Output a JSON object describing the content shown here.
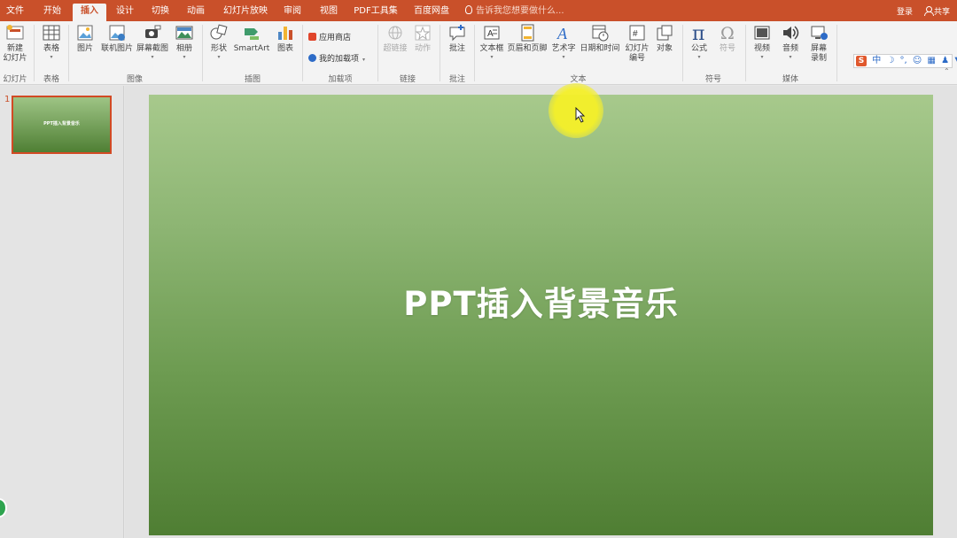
{
  "tabs": [
    {
      "label": "文件"
    },
    {
      "label": "开始"
    },
    {
      "label": "插入"
    },
    {
      "label": "设计"
    },
    {
      "label": "切换"
    },
    {
      "label": "动画"
    },
    {
      "label": "幻灯片放映"
    },
    {
      "label": "审阅"
    },
    {
      "label": "视图"
    },
    {
      "label": "PDF工具集"
    },
    {
      "label": "百度网盘"
    }
  ],
  "active_tab": "插入",
  "tell_me": "告诉我您想要做什么...",
  "login": "登录",
  "share": "共享",
  "ribbon": {
    "new_slide": "新建\n幻灯片",
    "table": "表格",
    "picture": "图片",
    "online_picture": "联机图片",
    "screenshot": "屏幕截图",
    "album": "相册",
    "shapes": "形状",
    "smartart": "SmartArt",
    "chart": "图表",
    "app_store": "应用商店",
    "my_addins": "我的加载项",
    "hyperlink": "超链接",
    "action": "动作",
    "comment": "批注",
    "textbox": "文本框",
    "header_footer": "页眉和页脚",
    "wordart": "艺术字",
    "datetime": "日期和时间",
    "slide_number": "幻灯片\n编号",
    "object": "对象",
    "equation": "公式",
    "symbol": "符号",
    "video": "视频",
    "audio": "音频",
    "screen_record": "屏幕\n录制"
  },
  "groups": {
    "slides": "幻灯片",
    "tables": "表格",
    "images": "图像",
    "illustrations": "插图",
    "addins": "加载项",
    "links": "链接",
    "comments": "批注",
    "text": "文本",
    "symbols": "符号",
    "media": "媒体"
  },
  "ime": {
    "logo": "S",
    "mode": "中"
  },
  "slides": [
    {
      "number": "1",
      "title": "PPT插入背景音乐"
    }
  ],
  "slide": {
    "title": "PPT插入背景音乐"
  },
  "colors": {
    "accent": "#c9502a",
    "slide_top": "#a7c98c",
    "slide_bottom": "#4f7e33"
  }
}
